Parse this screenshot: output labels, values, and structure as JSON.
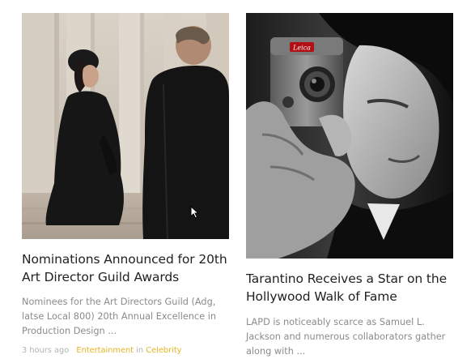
{
  "articles": [
    {
      "image_alt": "Nominations Announced for 20th Art Director Guild Awards",
      "title": "Nominations Announced for 20th Art Director Guild Awards",
      "excerpt": "Nominees for the Art Directors Guild (Adg, latse Local 800) 20th Annual Excellence in Production Design ...",
      "time": "3 hours ago",
      "category": "Entertainment",
      "in_word": "in",
      "subcategory": "Celebrity"
    },
    {
      "image_alt": "Tarantino Receives a Star on the Hollywood Walk of Fame",
      "title": "Tarantino Receives a Star on the Hollywood Walk of Fame",
      "excerpt": "LAPD is noticeably scarce as Samuel L. Jackson and numerous collaborators gather along with ..."
    }
  ],
  "camera_brand": "Leica",
  "colors": {
    "accent": "#e6b422",
    "title": "#222222",
    "excerpt": "#8b8b8b",
    "meta": "#b3b3b3"
  }
}
